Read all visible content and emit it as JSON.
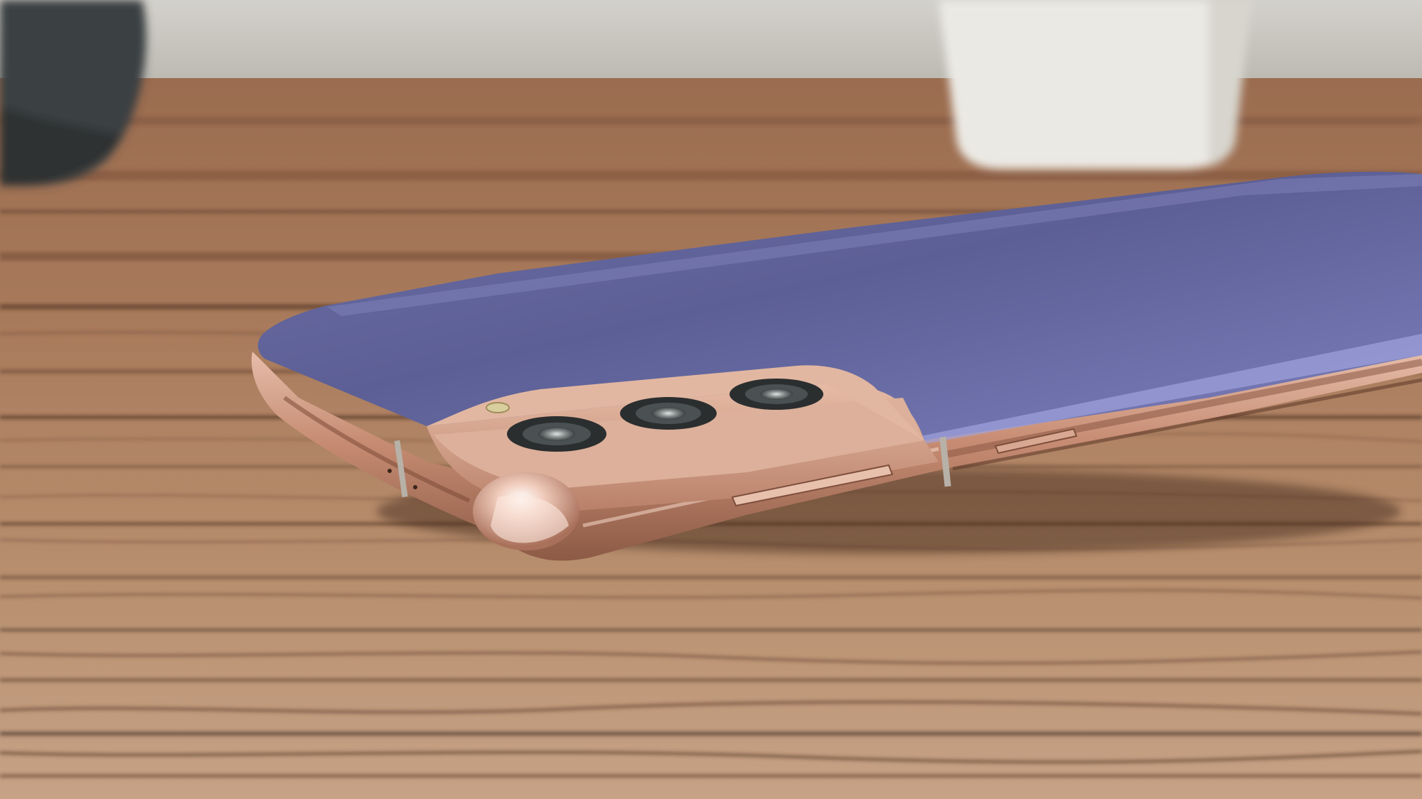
{
  "scene": {
    "subject": "smartphone-back",
    "colors": {
      "wall": "#c9c7c0",
      "table_light": "#b58766",
      "table_mid": "#8e6246",
      "table_dark": "#4a3022",
      "phone_back": "#5f6296",
      "phone_back_highlight": "#8a8cc4",
      "frame_bronze": "#c9917a",
      "frame_bronze_highlight": "#f3d2c2",
      "camera_housing": "#d6a88f",
      "lens_ring": "#2b2e2f",
      "lens_glass": "#8a9190",
      "cup": "#e9e7e2",
      "speaker": "#3e4547"
    }
  }
}
